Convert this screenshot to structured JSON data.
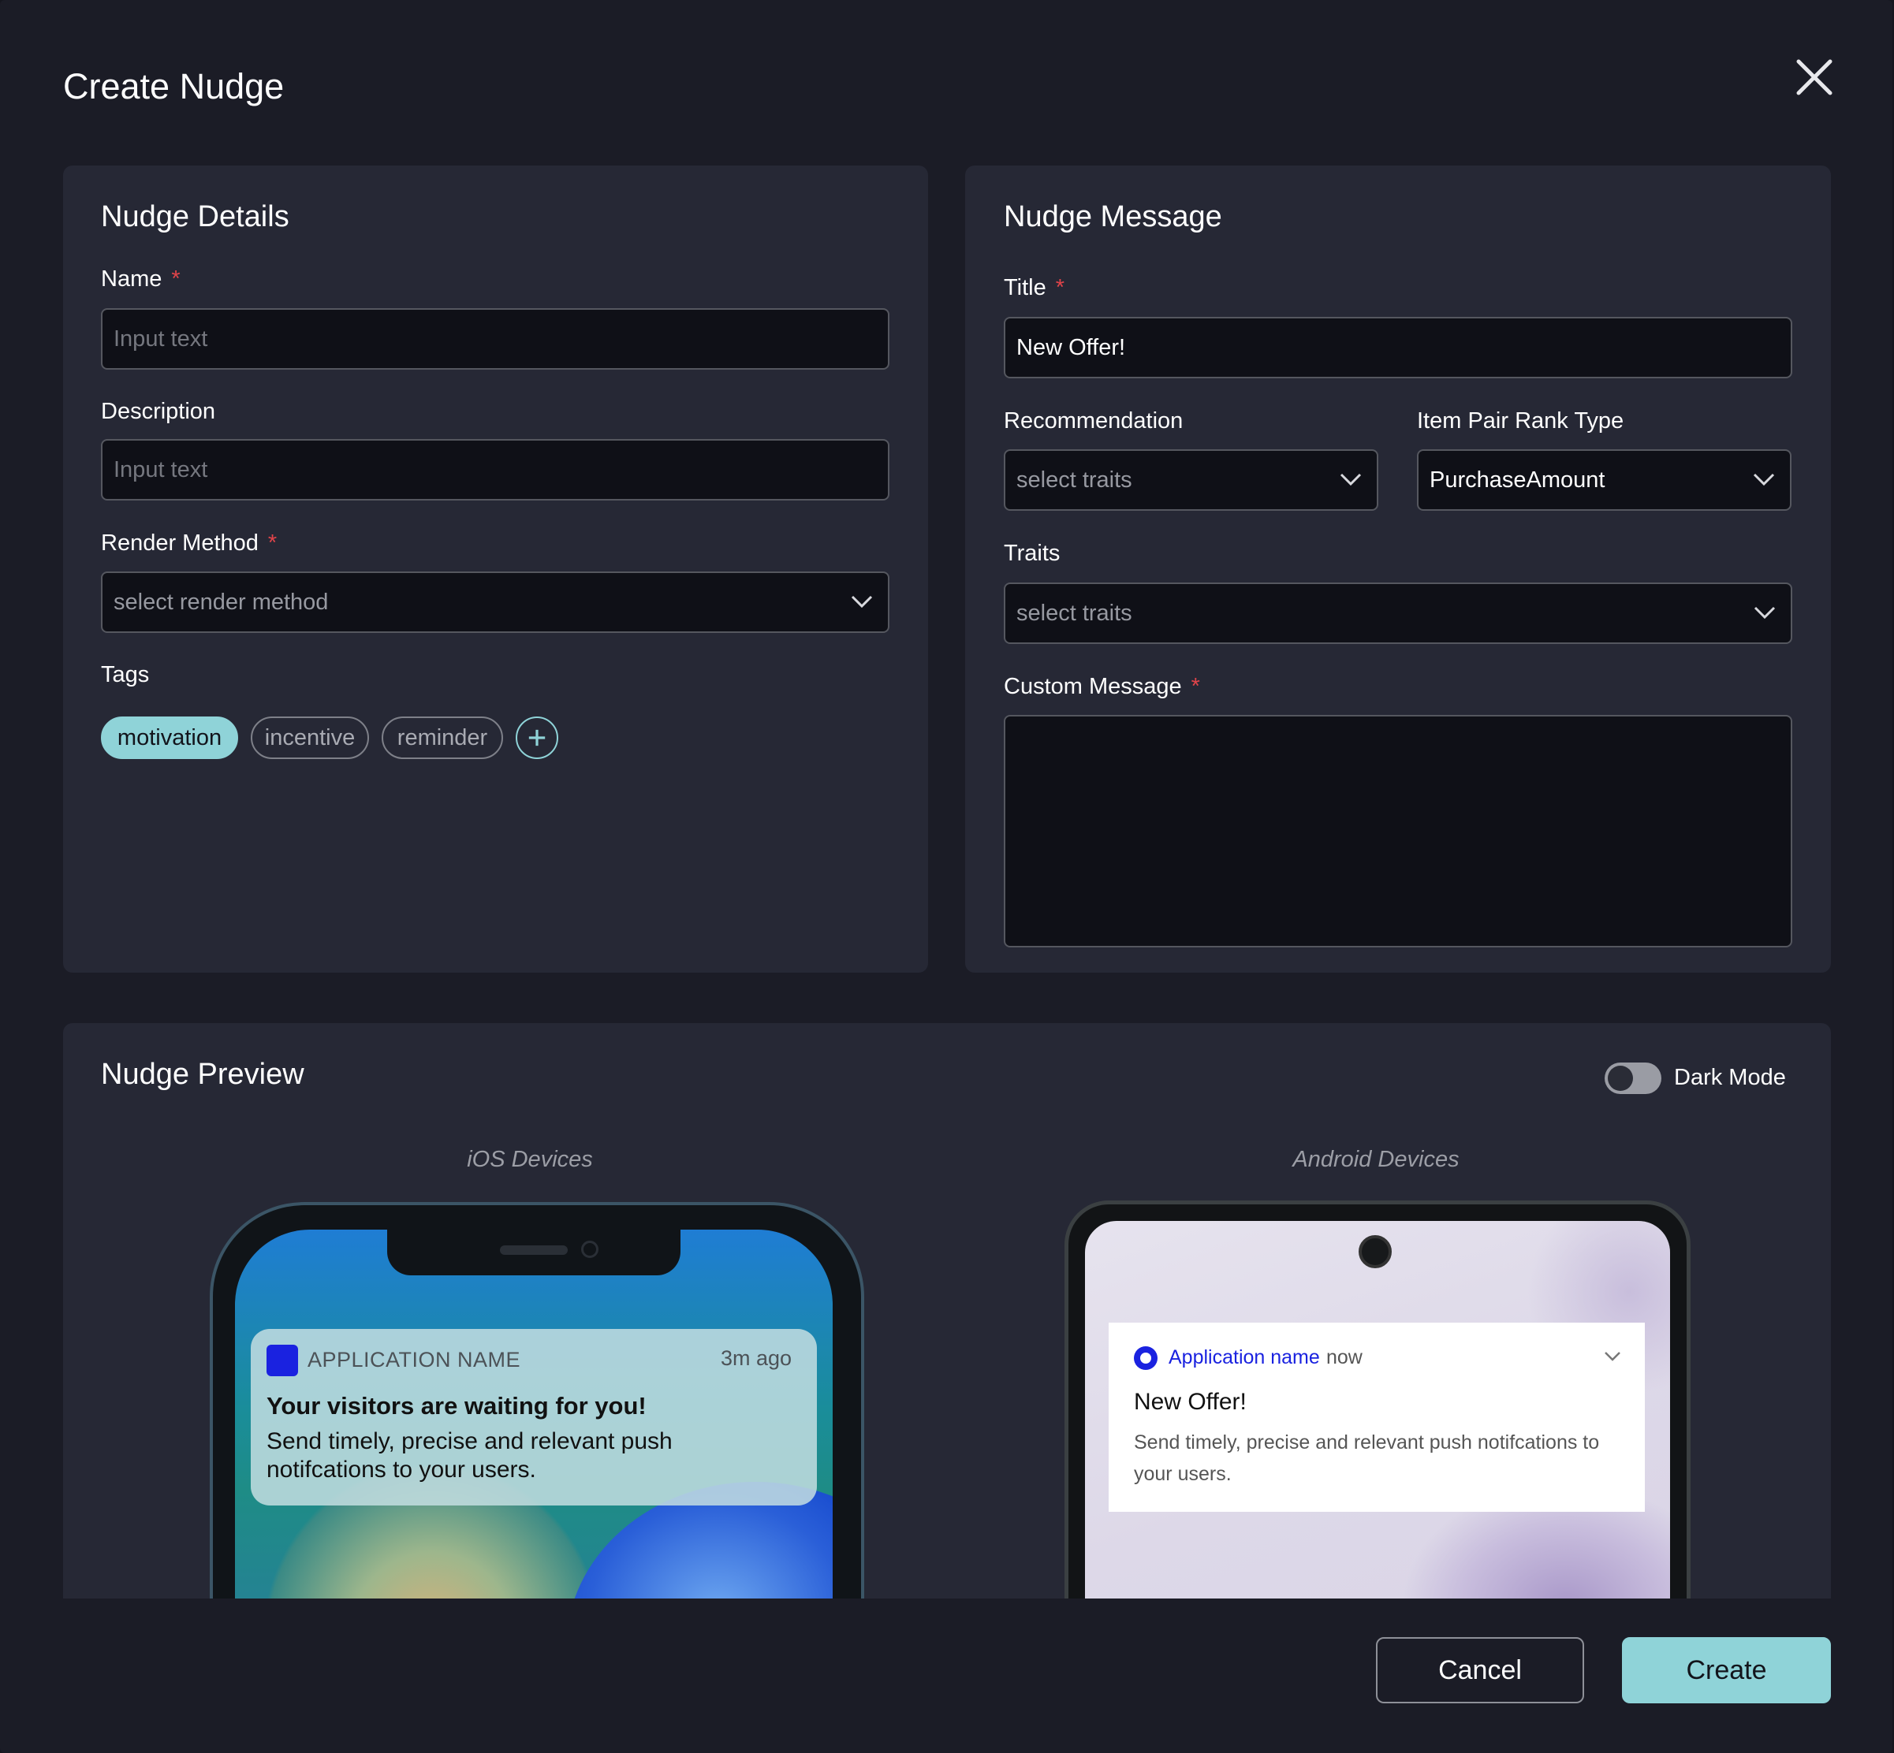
{
  "modal": {
    "title": "Create Nudge"
  },
  "details": {
    "title": "Nudge Details",
    "name": {
      "label": "Name",
      "placeholder": "Input text",
      "value": ""
    },
    "description": {
      "label": "Description",
      "placeholder": "Input text",
      "value": ""
    },
    "render_method": {
      "label": "Render Method",
      "placeholder": "select render method"
    },
    "tags": {
      "label": "Tags",
      "items": [
        {
          "label": "motivation",
          "active": true
        },
        {
          "label": "incentive",
          "active": false
        },
        {
          "label": "reminder",
          "active": false
        }
      ]
    }
  },
  "message": {
    "title": "Nudge Message",
    "title_field": {
      "label": "Title",
      "value": "New Offer!"
    },
    "recommendation": {
      "label": "Recommendation",
      "placeholder": "select traits"
    },
    "item_pair_rank_type": {
      "label": "Item Pair Rank Type",
      "value": "PurchaseAmount"
    },
    "traits": {
      "label": "Traits",
      "placeholder": "select traits"
    },
    "custom_message": {
      "label": "Custom Message",
      "value": ""
    }
  },
  "preview": {
    "title": "Nudge Preview",
    "dark_mode": {
      "label": "Dark Mode",
      "on": false
    },
    "ios": {
      "label": "iOS Devices",
      "app_name": "APPLICATION NAME",
      "time": "3m ago",
      "notif_title": "Your visitors are waiting for you!",
      "notif_body": "Send timely, precise and relevant push notifcations to your users."
    },
    "android": {
      "label": "Android Devices",
      "app_name": "Application name",
      "time": "now",
      "notif_title": "New Offer!",
      "notif_body": "Send timely, precise and relevant push notifcations to your users."
    }
  },
  "footer": {
    "cancel_label": "Cancel",
    "create_label": "Create"
  },
  "colors": {
    "accent": "#8fd3d8",
    "required": "#e0444a",
    "background": "#1b1c26",
    "card": "#262835",
    "app_icon": "#1a22e0"
  }
}
